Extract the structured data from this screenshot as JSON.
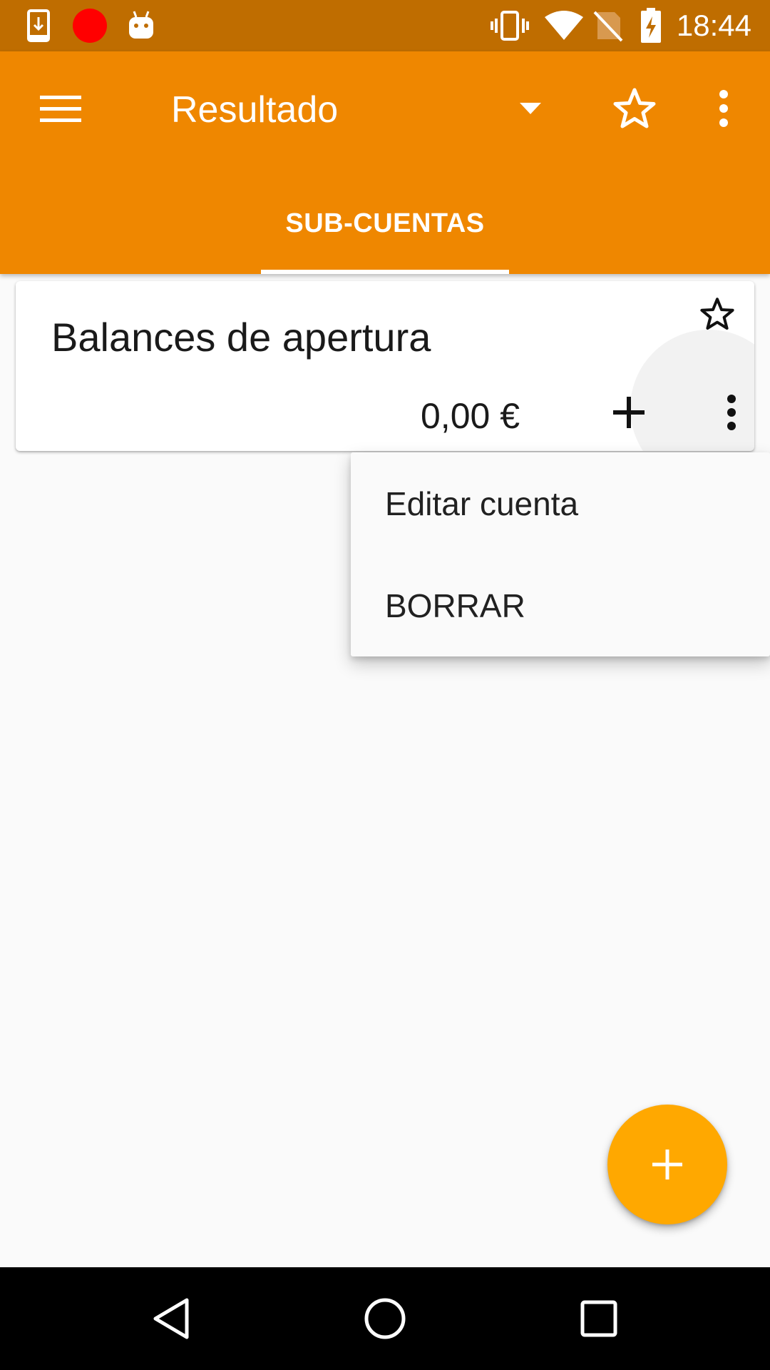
{
  "status_bar": {
    "time": "18:44",
    "left_icons": [
      "download-icon",
      "record-dot-icon",
      "android-icon"
    ],
    "right_icons": [
      "vibrate-icon",
      "wifi-icon",
      "no-sim-icon",
      "battery-charging-icon"
    ]
  },
  "app_bar": {
    "title": "Resultado",
    "icons": [
      "menu-icon",
      "dropdown-arrow-icon",
      "star-outline-icon",
      "more-vert-icon"
    ],
    "tabs": [
      {
        "label": "SUB-CUENTAS",
        "selected": true
      }
    ]
  },
  "account_card": {
    "name": "Balances de apertura",
    "balance": "0,00 €",
    "icons": [
      "star-outline-icon",
      "plus-icon",
      "more-vert-icon"
    ]
  },
  "popup_menu": {
    "items": [
      {
        "label": "Editar cuenta"
      },
      {
        "label": "BORRAR"
      }
    ]
  },
  "fab": {
    "icon": "plus-icon"
  },
  "nav_bar": {
    "icons": [
      "back-icon",
      "home-icon",
      "recents-icon"
    ]
  },
  "colors": {
    "status_bar": "#bf6d00",
    "app_bar": "#ef8700",
    "fab": "#ffa800",
    "background": "#fafafa"
  }
}
